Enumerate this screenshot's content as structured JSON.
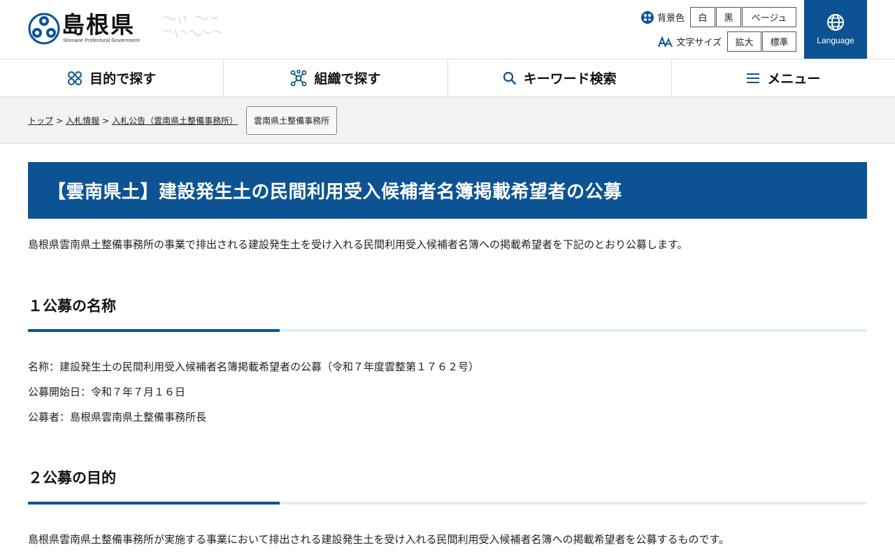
{
  "header": {
    "logo_name": "島根県",
    "logo_sub": "Shimane Prefectural Government",
    "bg_color_label": "背景色",
    "bg_white": "白",
    "bg_black": "黒",
    "bg_beige": "ベージュ",
    "font_size_label": "文字サイズ",
    "font_large": "拡大",
    "font_standard": "標準",
    "language": "Language"
  },
  "nav": {
    "purpose": "目的で探す",
    "organization": "組織で探す",
    "keyword": "キーワード検索",
    "menu": "メニュー"
  },
  "breadcrumb": {
    "top": "トップ",
    "bid_info": "入札情報",
    "bid_notice": "入札公告（雲南県土整備事務所）",
    "current": "雲南県土整備事務所",
    "separator": ">"
  },
  "page_title": "【雲南県土】建設発生土の民間利用受入候補者名簿掲載希望者の公募",
  "intro": "島根県雲南県土整備事務所の事業で排出される建設発生土を受け入れる民間利用受入候補者名簿への掲載希望者を下記のとおり公募します。",
  "section1": {
    "heading": "１公募の名称",
    "name_line": "名称：建設発生土の民間利用受入候補者名簿掲載希望者の公募（令和７年度雲整第１７６２号）",
    "start_line": "公募開始日：令和７年７月１６日",
    "org_line": "公募者：島根県雲南県土整備事務所長"
  },
  "section2": {
    "heading": "２公募の目的",
    "body": "島根県雲南県土整備事務所が実施する事業において排出される建設発生土を受け入れる民間利用受入候補者名簿への掲載希望者を公募するものです。"
  },
  "colors": {
    "brand": "#0d5393",
    "accent_light": "#dfeefb"
  }
}
